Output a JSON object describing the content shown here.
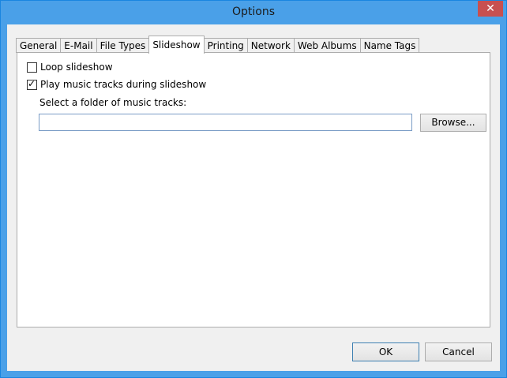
{
  "window": {
    "title": "Options",
    "close_glyph": "✕"
  },
  "tabs": [
    {
      "label": "General",
      "active": false
    },
    {
      "label": "E-Mail",
      "active": false
    },
    {
      "label": "File Types",
      "active": false
    },
    {
      "label": "Slideshow",
      "active": true
    },
    {
      "label": "Printing",
      "active": false
    },
    {
      "label": "Network",
      "active": false
    },
    {
      "label": "Web Albums",
      "active": false
    },
    {
      "label": "Name Tags",
      "active": false
    }
  ],
  "slideshow": {
    "loop": {
      "label": "Loop slideshow",
      "checked": false
    },
    "play_music": {
      "label": "Play music tracks during slideshow",
      "checked": true
    },
    "folder_label": "Select a folder of music tracks:",
    "folder_value": "",
    "browse_label": "Browse..."
  },
  "footer": {
    "ok_label": "OK",
    "cancel_label": "Cancel"
  },
  "icons": {
    "check": "✓"
  }
}
